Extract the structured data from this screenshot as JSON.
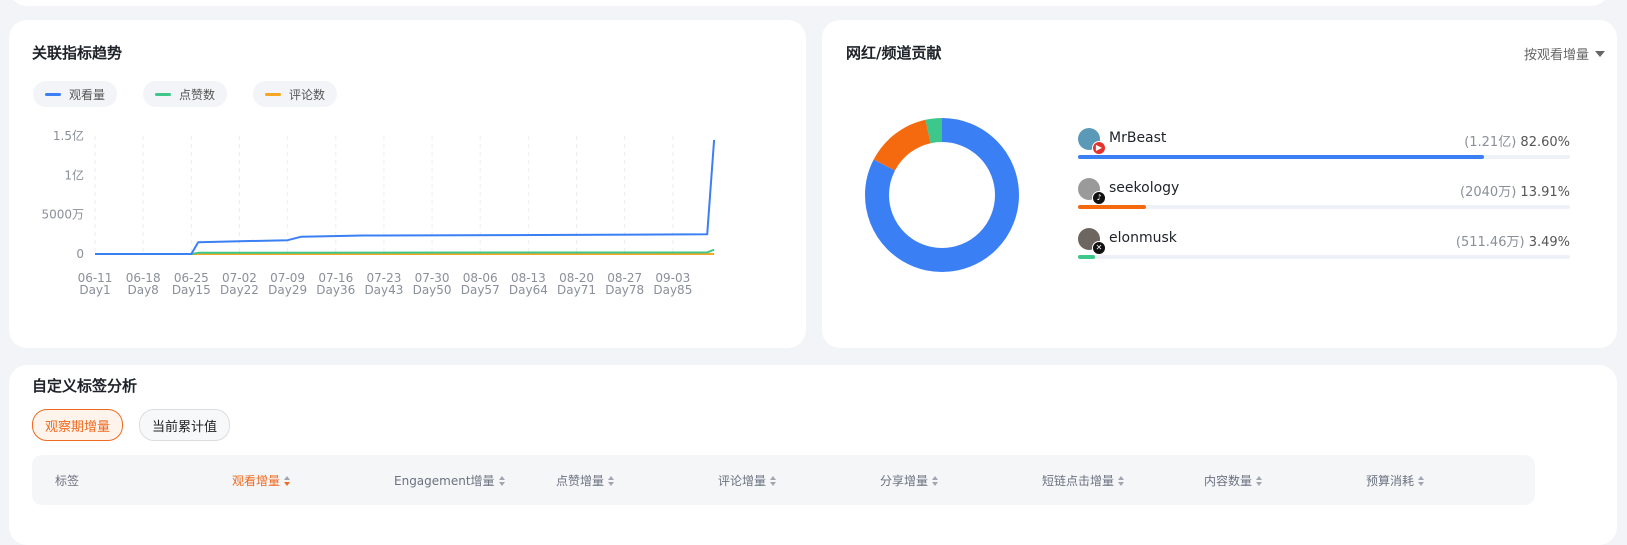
{
  "trend": {
    "title": "关联指标趋势",
    "legend": [
      {
        "label": "观看量",
        "color": "#3b7ff5"
      },
      {
        "label": "点赞数",
        "color": "#3ec78a"
      },
      {
        "label": "评论数",
        "color": "#f5a623"
      }
    ],
    "y_ticks": [
      "1.5亿",
      "1亿",
      "5000万",
      "0"
    ],
    "x_ticks": [
      {
        "date": "06-11",
        "day": "Day1"
      },
      {
        "date": "06-18",
        "day": "Day8"
      },
      {
        "date": "06-25",
        "day": "Day15"
      },
      {
        "date": "07-02",
        "day": "Day22"
      },
      {
        "date": "07-09",
        "day": "Day29"
      },
      {
        "date": "07-16",
        "day": "Day36"
      },
      {
        "date": "07-23",
        "day": "Day43"
      },
      {
        "date": "07-30",
        "day": "Day50"
      },
      {
        "date": "08-06",
        "day": "Day57"
      },
      {
        "date": "08-13",
        "day": "Day64"
      },
      {
        "date": "08-20",
        "day": "Day71"
      },
      {
        "date": "08-27",
        "day": "Day78"
      },
      {
        "date": "09-03",
        "day": "Day85"
      }
    ]
  },
  "chart_data": {
    "type": "line",
    "x_unit": "day",
    "ylim": [
      0,
      150000000
    ],
    "series": [
      {
        "name": "观看量",
        "color": "#3b7ff5",
        "points": [
          [
            1,
            0
          ],
          [
            15,
            0
          ],
          [
            16,
            15000000
          ],
          [
            29,
            17500000
          ],
          [
            31,
            22000000
          ],
          [
            40,
            23500000
          ],
          [
            60,
            24000000
          ],
          [
            90,
            25000000
          ],
          [
            91,
            145000000
          ]
        ]
      },
      {
        "name": "点赞数",
        "color": "#3ec78a",
        "points": [
          [
            1,
            0
          ],
          [
            15,
            0
          ],
          [
            16,
            1500000
          ],
          [
            90,
            2000000
          ],
          [
            91,
            5500000
          ]
        ]
      },
      {
        "name": "评论数",
        "color": "#f5a623",
        "points": [
          [
            1,
            0
          ],
          [
            91,
            0
          ]
        ]
      }
    ]
  },
  "contrib": {
    "title": "网红/频道贡献",
    "sort_label": "按观看增量",
    "items": [
      {
        "name": "MrBeast",
        "value": "(1.21亿)",
        "percent": "82.60%",
        "share": 0.826,
        "color": "#3b7ff5",
        "platform": "youtube-icon",
        "badge_color": "#e5322d"
      },
      {
        "name": "seekology",
        "value": "(2040万)",
        "percent": "13.91%",
        "share": 0.1391,
        "color": "#f5690f",
        "platform": "tiktok-icon",
        "badge_color": "#111111"
      },
      {
        "name": "elonmusk",
        "value": "(511.46万)",
        "percent": "3.49%",
        "share": 0.0349,
        "color": "#3ec78a",
        "platform": "x-icon",
        "badge_color": "#111111"
      }
    ]
  },
  "tags": {
    "title": "自定义标签分析",
    "tabs": [
      "观察期增量",
      "当前累计值"
    ],
    "active_tab": 0,
    "columns": [
      "标签",
      "观看增量",
      "Engagement增量",
      "点赞增量",
      "评论增量",
      "分享增量",
      "短链点击增量",
      "内容数量",
      "预算消耗"
    ]
  }
}
